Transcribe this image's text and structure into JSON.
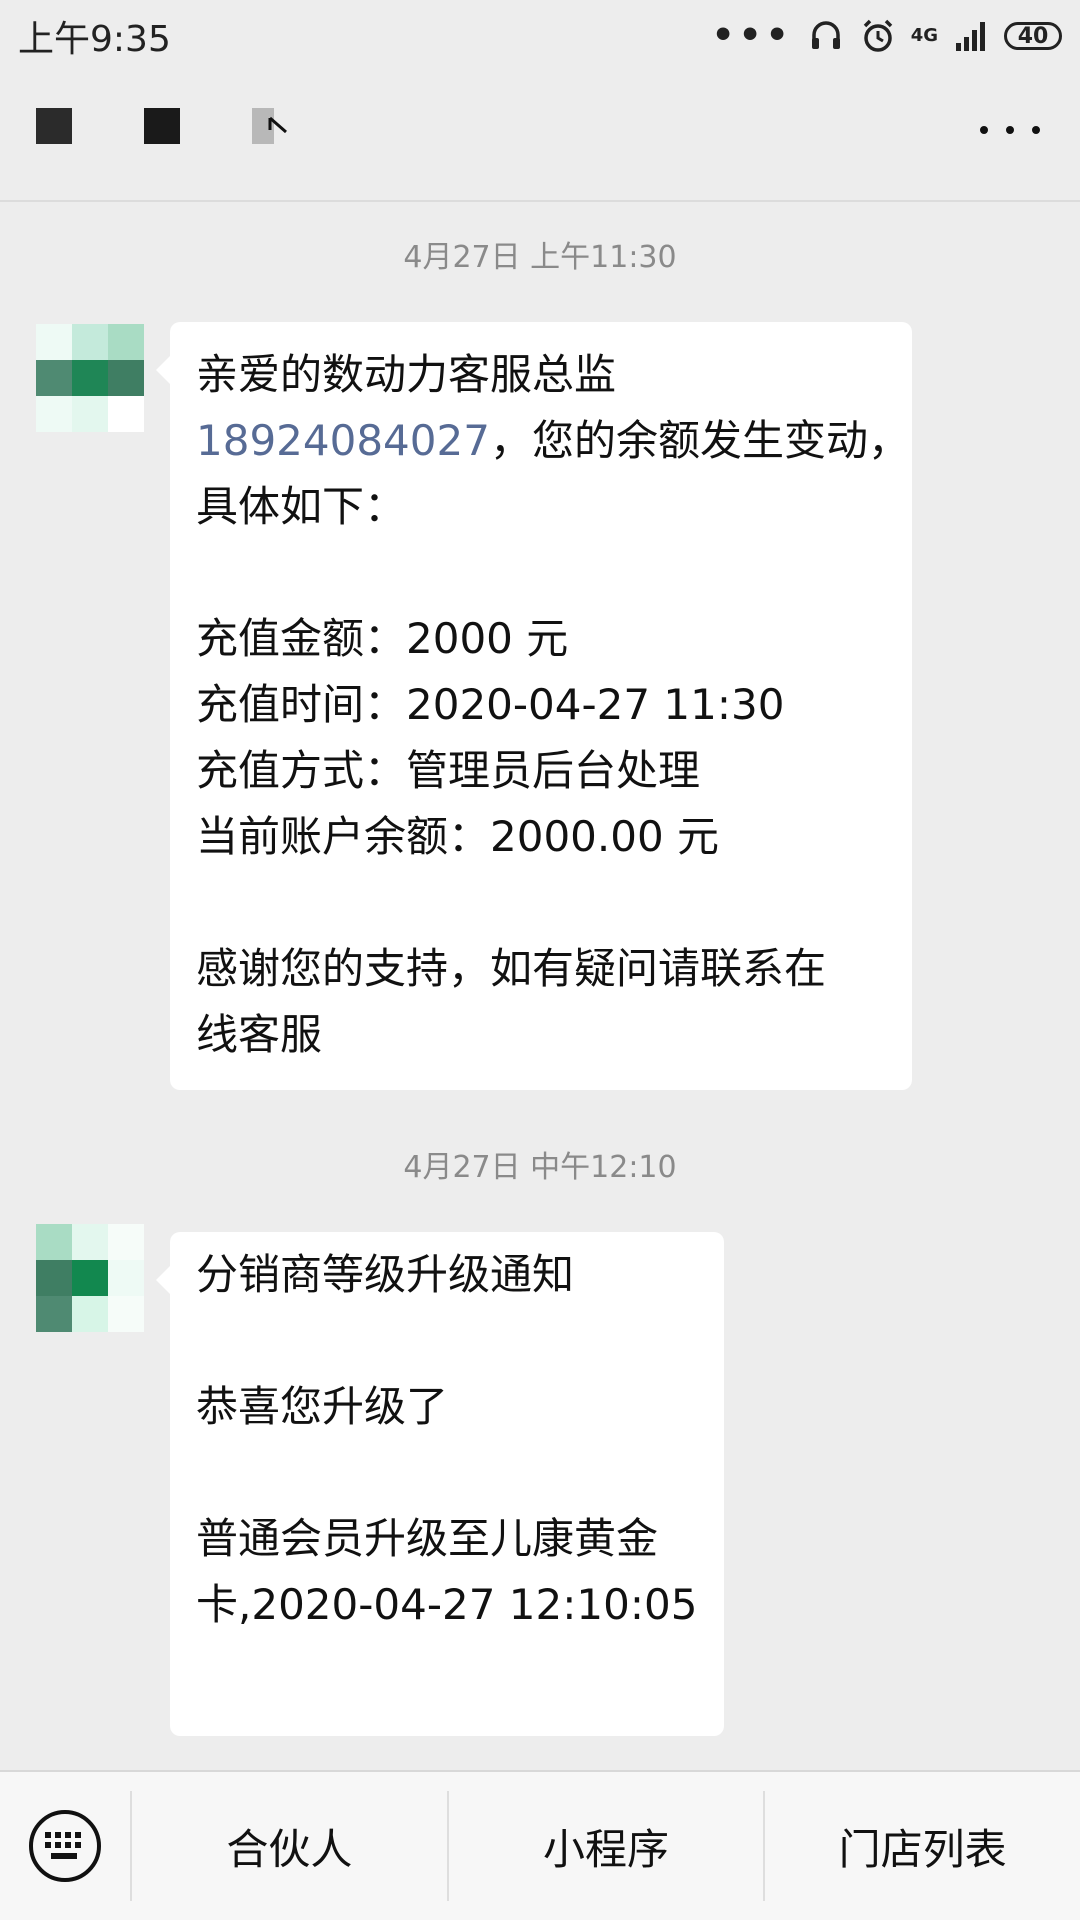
{
  "status_bar": {
    "time": "上午9:35",
    "overflow_dots": "•••",
    "network": "4G",
    "battery": "40"
  },
  "chat": {
    "messages": [
      {
        "timestamp": "4月27日 上午11:30",
        "lines": [
          "亲爱的数动力客服总监",
          "18924084027",
          "，您的余额发生变动，",
          "具体如下：",
          "",
          "充值金额：2000 元",
          "充值时间：2020-04-27 11:30",
          "充值方式：管理员后台处理",
          "当前账户余额：2000.00 元",
          "",
          "感谢您的支持，如有疑问请联系在",
          "线客服"
        ]
      },
      {
        "timestamp": "4月27日 中午12:10",
        "lines": [
          "分销商等级升级通知",
          "",
          "恭喜您升级了",
          "",
          "普通会员升级至儿康黄金",
          "卡,2020-04-27 12:10:05"
        ]
      }
    ]
  },
  "bottom_menu": {
    "items": [
      "合伙人",
      "小程序",
      "门店列表"
    ]
  },
  "colors": {
    "background": "#ededed",
    "bubble": "#ffffff",
    "link": "#576b95",
    "timestamp": "#8a8a8a"
  }
}
